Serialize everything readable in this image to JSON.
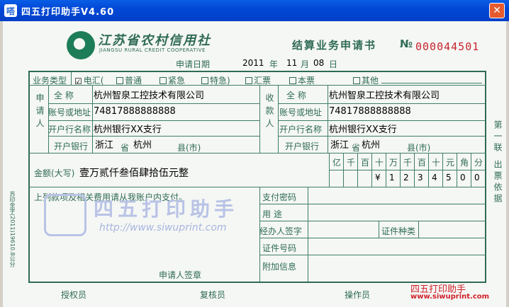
{
  "window": {
    "title": "四五打印助手V4.60",
    "close": "✕",
    "app_icon_glyph": "嗒"
  },
  "header": {
    "bank_name": "江苏省农村信用社",
    "bank_eng": "JIANGSU RURAL CREDIT COOPERATIVE",
    "form_title": "结算业务申请书",
    "no_label": "№",
    "no_value": "000044501"
  },
  "date": {
    "label": "申请日期",
    "year": "2011",
    "year_unit": "年",
    "month": "11",
    "month_unit": "月",
    "day": "08",
    "day_unit": "日"
  },
  "business_type": {
    "label": "业务类型",
    "options": [
      {
        "label": "电汇",
        "checked": true
      },
      {
        "label": "普通",
        "checked": false
      },
      {
        "label": "紧急",
        "checked": false
      },
      {
        "label": "特急",
        "checked": false
      },
      {
        "label": "汇票",
        "checked": false
      },
      {
        "label": "本票",
        "checked": false
      },
      {
        "label": "其他",
        "checked": false
      }
    ],
    "paren_open": "(",
    "paren_close": ")"
  },
  "applicant": {
    "section_label": "申请人",
    "name_label": "全   称",
    "name": "杭州智泉工控技术有限公司",
    "account_label": "账号或地址",
    "account": "74817888888888",
    "bank_label": "开户行名称",
    "bank": "杭州银行XX支行",
    "open_bank_label": "开户银行",
    "province": "浙江",
    "province_unit": "省",
    "city": "杭州",
    "city_unit": "县(市)"
  },
  "payee": {
    "section_label": "收款人",
    "name_label": "全   称",
    "name": "杭州智泉工控技术有限公司",
    "account_label": "账号或地址",
    "account": "74817888888888",
    "bank_label": "开户行名称",
    "bank": "杭州银行XX支行",
    "open_bank_label": "开户银行",
    "province": "浙江",
    "province_unit": "省",
    "city": "杭州",
    "city_unit": "县(市)"
  },
  "amount": {
    "label": "金额(大写)",
    "words": "壹万贰仟叁佰肆拾伍元整",
    "digit_headers": [
      "亿",
      "千",
      "百",
      "十",
      "万",
      "千",
      "百",
      "十",
      "元",
      "角",
      "分"
    ],
    "digits": [
      "",
      "",
      "",
      "¥",
      "1",
      "2",
      "3",
      "4",
      "5",
      "0",
      "0"
    ]
  },
  "notice": "上列款项及相关费用请从我账户内支付。",
  "signature_label": "申请人签章",
  "right_block": {
    "password_label": "支付密码",
    "purpose_label": "用   途",
    "handler_label": "经办人签字",
    "id_type_label": "证件种类",
    "id_no_label": "证件号码",
    "extra_label": "附加信息"
  },
  "footer": {
    "auth_label": "授权员",
    "review_label": "复核员",
    "operator_label": "操作员"
  },
  "side_note": "第一联  出票依据",
  "left_note": "苏印金字(2011)19610.8公分",
  "watermark": {
    "text": "四五打印助手",
    "url": "http://www.siwuprint.com"
  },
  "brand": {
    "cn": "四五打印助手",
    "url": "www.siwuprint.com"
  }
}
